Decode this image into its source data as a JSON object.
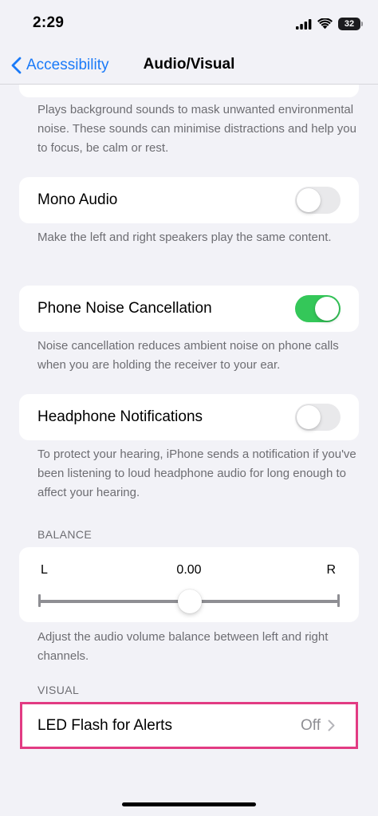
{
  "status_bar": {
    "time": "2:29",
    "battery": "32"
  },
  "nav": {
    "back_label": "Accessibility",
    "title": "Audio/Visual"
  },
  "background_sounds": {
    "footer": "Plays background sounds to mask unwanted environmental noise. These sounds can minimise distractions and help you to focus, be calm or rest."
  },
  "mono_audio": {
    "label": "Mono Audio",
    "enabled": false,
    "footer": "Make the left and right speakers play the same content."
  },
  "phone_noise_cancellation": {
    "label": "Phone Noise Cancellation",
    "enabled": true,
    "footer": "Noise cancellation reduces ambient noise on phone calls when you are holding the receiver to your ear."
  },
  "headphone_notifications": {
    "label": "Headphone Notifications",
    "enabled": false,
    "footer": "To protect your hearing, iPhone sends a notification if you've been listening to loud headphone audio for long enough to affect your hearing."
  },
  "balance": {
    "header": "BALANCE",
    "left_label": "L",
    "right_label": "R",
    "value": "0.00",
    "fraction": 0.5,
    "footer": "Adjust the audio volume balance between left and right channels."
  },
  "visual": {
    "header": "VISUAL",
    "led_flash_label": "LED Flash for Alerts",
    "led_flash_value": "Off"
  },
  "colors": {
    "accent": "#1a7af8",
    "toggle_on": "#34c759",
    "highlight": "#e23b83"
  }
}
